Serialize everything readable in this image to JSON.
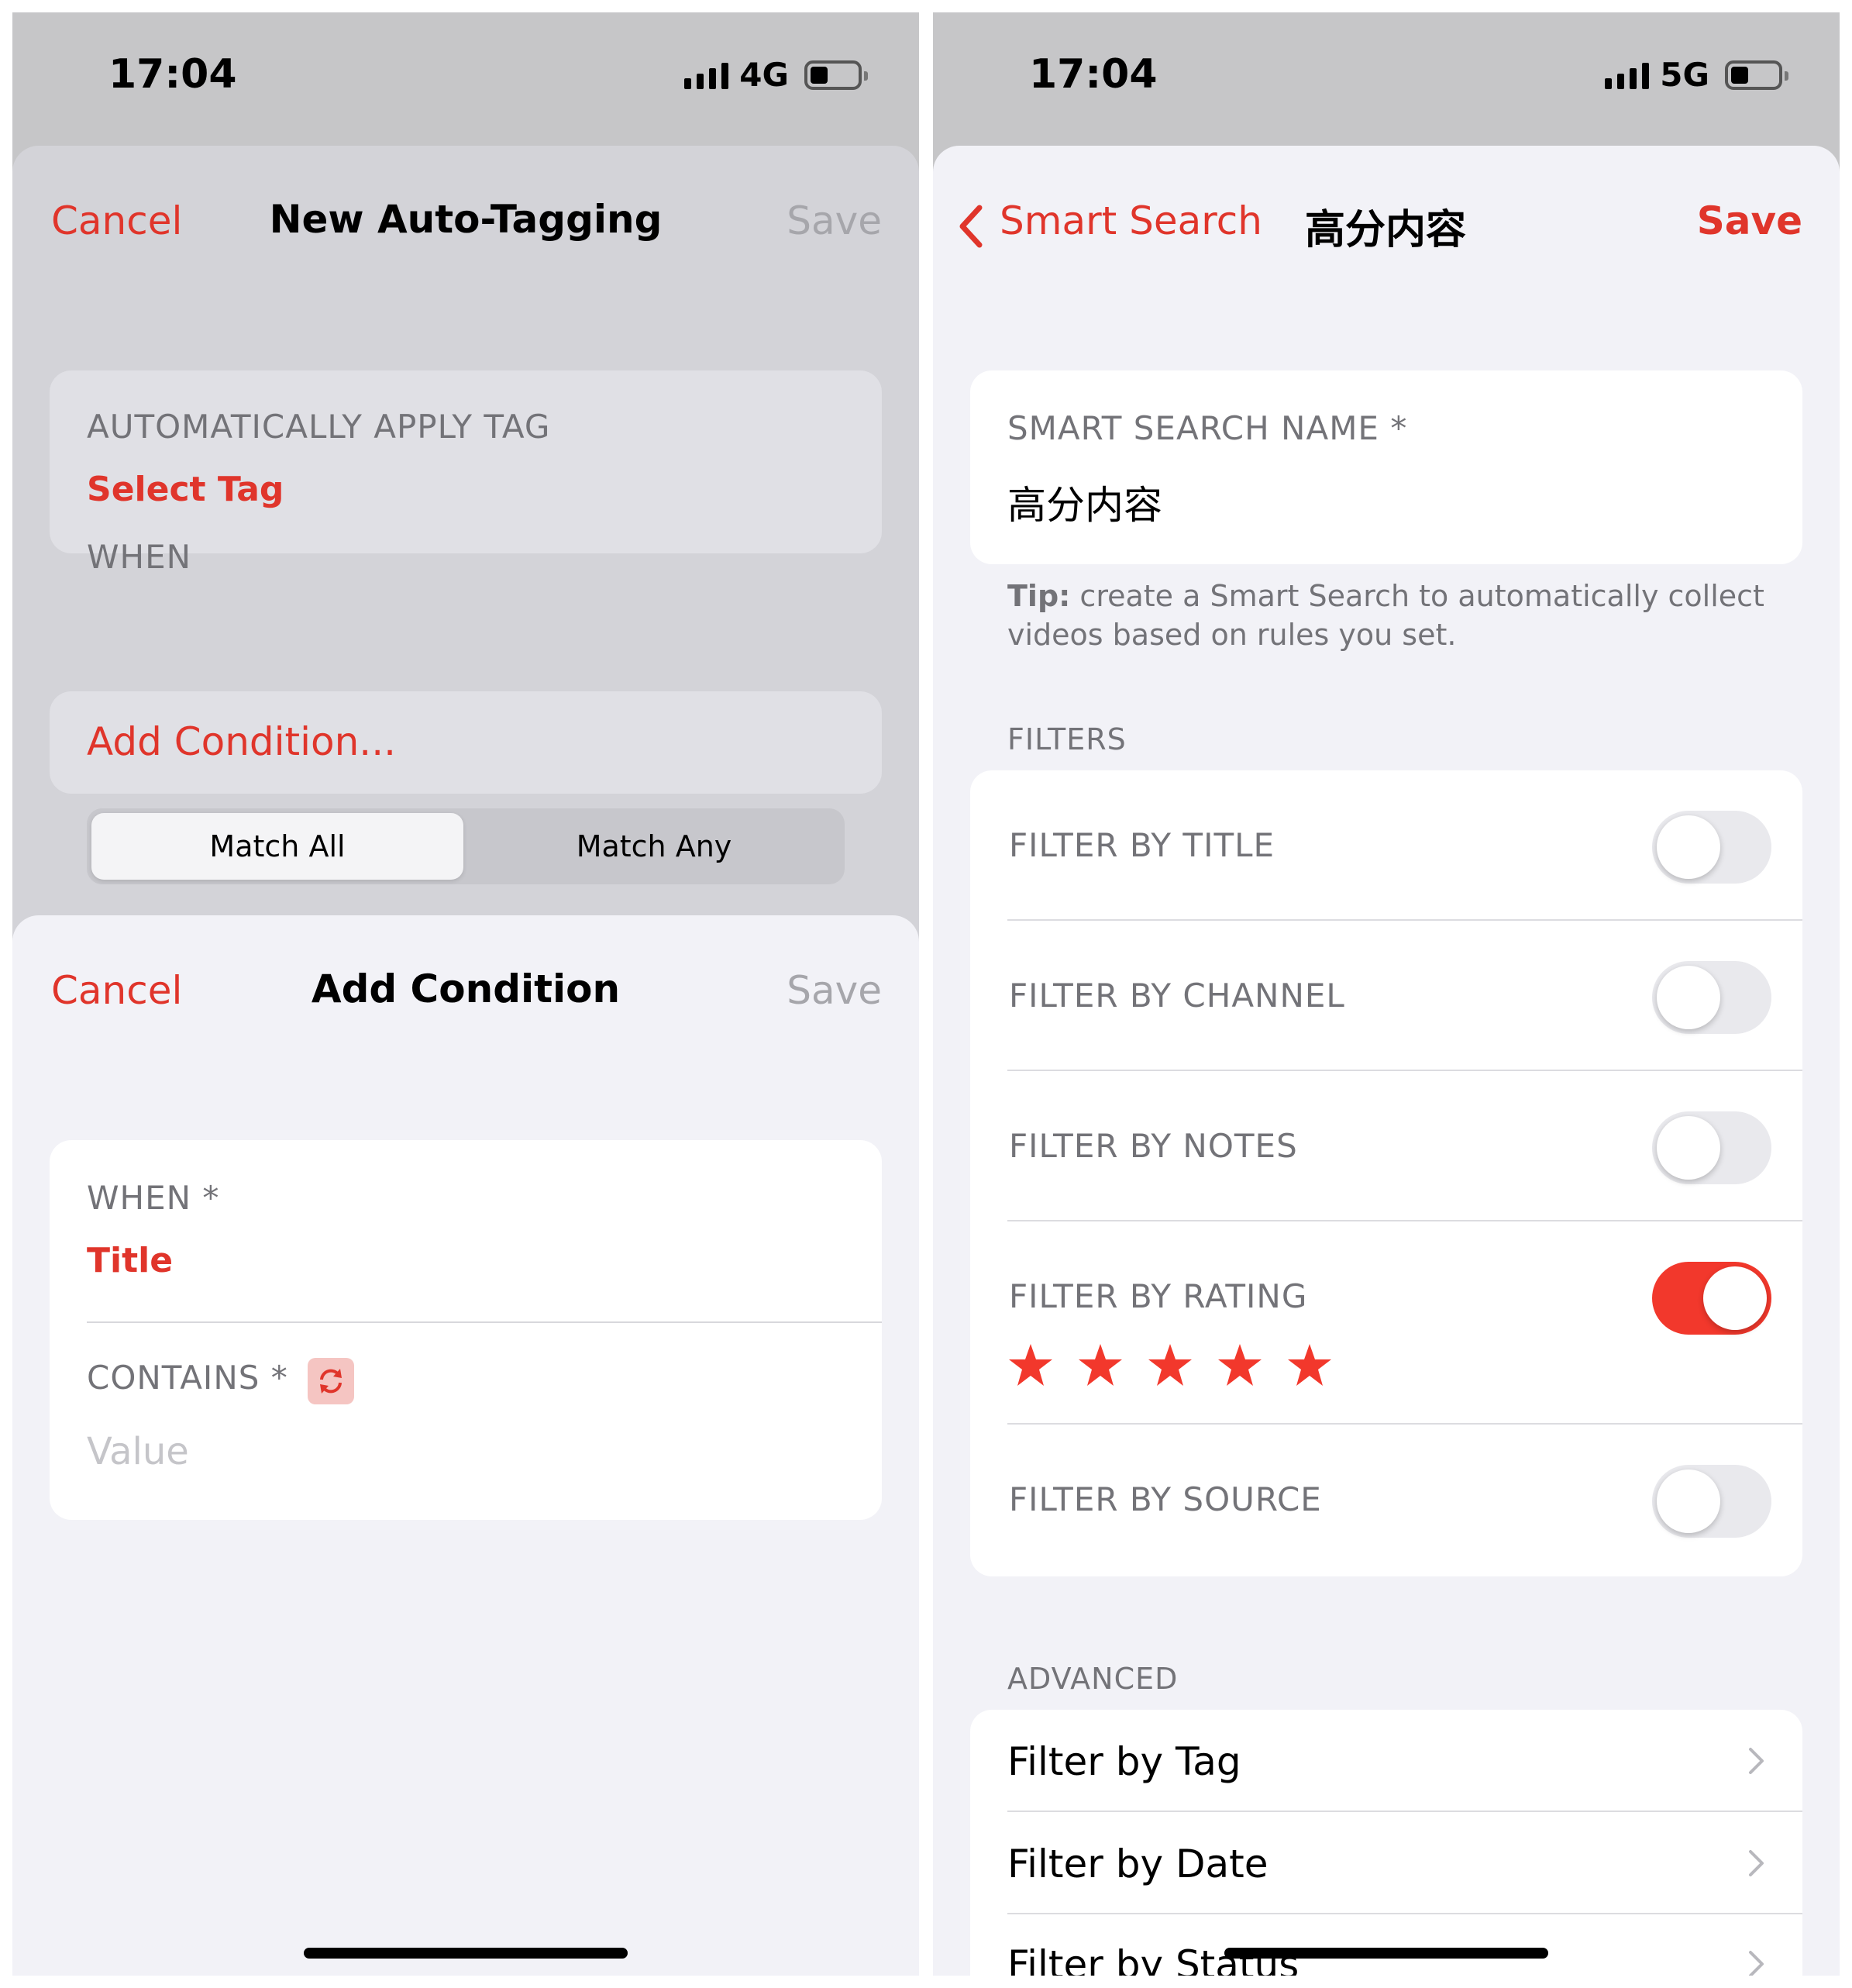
{
  "left": {
    "status": {
      "time": "17:04",
      "network": "4G"
    },
    "back_sheet": {
      "cancel": "Cancel",
      "title": "New Auto-Tagging",
      "save": "Save",
      "apply_tag_label": "AUTOMATICALLY APPLY TAG",
      "select_tag": "Select Tag",
      "when_label": "WHEN",
      "add_condition": "Add Condition...",
      "segments": [
        "Match All",
        "Match Any"
      ]
    },
    "front_sheet": {
      "cancel": "Cancel",
      "title": "Add Condition",
      "save": "Save",
      "when_label": "WHEN *",
      "when_value": "Title",
      "contains_label": "CONTAINS *",
      "value_placeholder": "Value"
    }
  },
  "right": {
    "status": {
      "time": "17:04",
      "network": "5G"
    },
    "nav": {
      "back": "Smart Search",
      "title": "高分内容",
      "save": "Save"
    },
    "name_label": "SMART SEARCH NAME *",
    "name_value": "高分内容",
    "tip_bold": "Tip:",
    "tip_text": " create a Smart Search to automatically collect videos based on rules you set.",
    "filters_header": "FILTERS",
    "filters": [
      {
        "label": "FILTER BY TITLE",
        "on": false
      },
      {
        "label": "FILTER BY CHANNEL",
        "on": false
      },
      {
        "label": "FILTER BY NOTES",
        "on": false
      },
      {
        "label": "FILTER BY RATING",
        "on": true,
        "rating": 5
      },
      {
        "label": "FILTER BY SOURCE",
        "on": false
      }
    ],
    "advanced_header": "ADVANCED",
    "advanced": [
      "Filter by Tag",
      "Filter by Date",
      "Filter by Status"
    ]
  },
  "colors": {
    "accent": "#e0352b",
    "toggle_on": "#f2382c"
  }
}
